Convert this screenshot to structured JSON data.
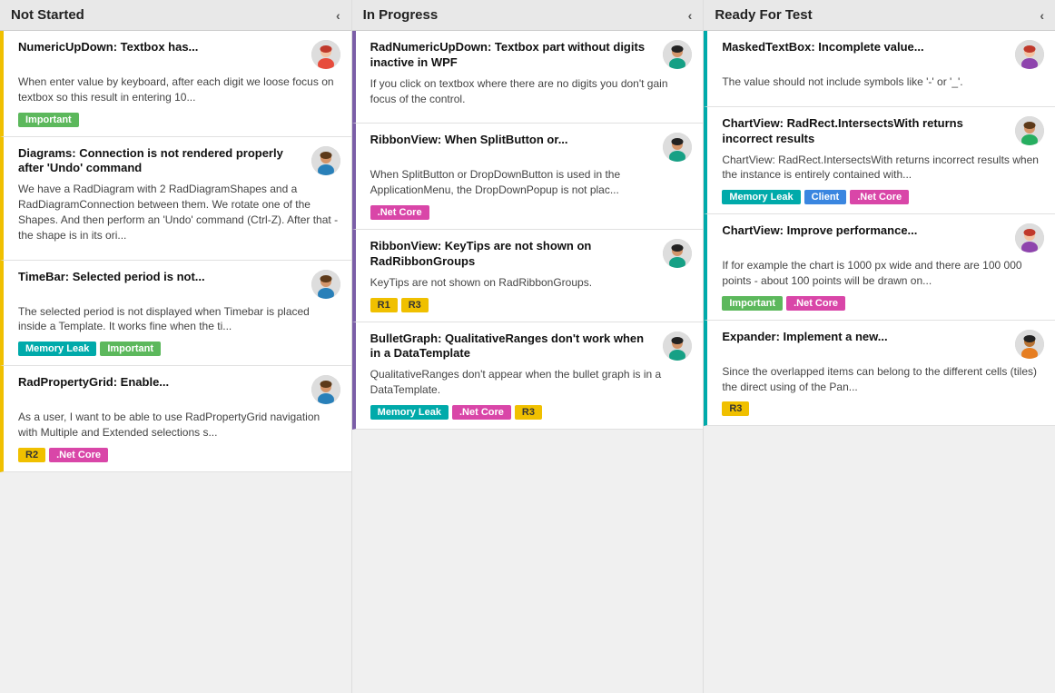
{
  "columns": [
    {
      "id": "not-started",
      "label": "Not Started",
      "cards": [
        {
          "id": "card-1",
          "title": "NumericUpDown: Textbox has...",
          "desc": "When enter value by keyboard, after each digit we loose focus on textbox so this result in entering 10...",
          "tags": [
            {
              "label": "Important",
              "type": "important"
            }
          ],
          "border": "yellow-left",
          "avatar": "female1"
        },
        {
          "id": "card-2",
          "title": "Diagrams: Connection is not rendered properly after 'Undo' command",
          "desc": "We have a RadDiagram with 2 RadDiagramShapes and a RadDiagramConnection between them. We rotate one of the Shapes. And then perform an 'Undo' command (Ctrl-Z). After that - the shape is in its ori...",
          "tags": [],
          "border": "yellow-left",
          "avatar": "male1"
        },
        {
          "id": "card-3",
          "title": "TimeBar: Selected period is not...",
          "desc": "The selected period is not displayed when Timebar is placed inside a Template. It works fine when the ti...",
          "tags": [
            {
              "label": "Memory Leak",
              "type": "memoryleak"
            },
            {
              "label": "Important",
              "type": "important"
            }
          ],
          "border": "yellow-left",
          "avatar": "male1"
        },
        {
          "id": "card-4",
          "title": "RadPropertyGrid: Enable...",
          "desc": "As a user, I want to be able to use RadPropertyGrid navigation with Multiple and Extended selections s...",
          "tags": [
            {
              "label": "R2",
              "type": "r2"
            },
            {
              "label": ".Net Core",
              "type": "netcore"
            }
          ],
          "border": "yellow-left",
          "avatar": "male1"
        }
      ]
    },
    {
      "id": "in-progress",
      "label": "In Progress",
      "cards": [
        {
          "id": "card-5",
          "title": "RadNumericUpDown: Textbox part without digits inactive in WPF",
          "desc": "If you click on textbox where there are no digits you don't gain focus of the control.",
          "tags": [],
          "border": "purple-left",
          "avatar": "male2"
        },
        {
          "id": "card-6",
          "title": "RibbonView: When SplitButton or...",
          "desc": "When SplitButton or DropDownButton is used in the ApplicationMenu, the DropDownPopup is not plac...",
          "tags": [
            {
              "label": ".Net Core",
              "type": "netcore"
            }
          ],
          "border": "purple-left",
          "avatar": "male2"
        },
        {
          "id": "card-7",
          "title": "RibbonView: KeyTips are not shown on RadRibbonGroups",
          "desc": "KeyTips are not shown on RadRibbonGroups.",
          "tags": [
            {
              "label": "R1",
              "type": "r1"
            },
            {
              "label": "R3",
              "type": "r3"
            }
          ],
          "border": "purple-left",
          "avatar": "male2"
        },
        {
          "id": "card-8",
          "title": "BulletGraph: QualitativeRanges don't work when in a DataTemplate",
          "desc": "QualitativeRanges don't appear when the bullet graph is in a DataTemplate.",
          "tags": [
            {
              "label": "Memory Leak",
              "type": "memoryleak"
            },
            {
              "label": ".Net Core",
              "type": "netcore"
            },
            {
              "label": "R3",
              "type": "r3"
            }
          ],
          "border": "purple-left",
          "avatar": "male2"
        }
      ]
    },
    {
      "id": "ready-for-test",
      "label": "Ready For Test",
      "cards": [
        {
          "id": "card-9",
          "title": "MaskedTextBox: Incomplete value...",
          "desc": "The value should not include symbols like '-' or '_'.",
          "tags": [],
          "border": "teal-left",
          "avatar": "female2"
        },
        {
          "id": "card-10",
          "title": "ChartView: RadRect.IntersectsWith returns incorrect results",
          "desc": "ChartView: RadRect.IntersectsWith returns incorrect results when the instance is entirely contained with...",
          "tags": [
            {
              "label": "Memory Leak",
              "type": "memoryleak"
            },
            {
              "label": "Client",
              "type": "client"
            },
            {
              "label": ".Net Core",
              "type": "netcore"
            }
          ],
          "border": "teal-left",
          "avatar": "male3"
        },
        {
          "id": "card-11",
          "title": "ChartView: Improve performance...",
          "desc": "If for example the chart is 1000 px wide and there are 100 000 points - about 100 points will be drawn on...",
          "tags": [
            {
              "label": "Important",
              "type": "important"
            },
            {
              "label": ".Net Core",
              "type": "netcore"
            }
          ],
          "border": "teal-left",
          "avatar": "female2"
        },
        {
          "id": "card-12",
          "title": "Expander: Implement a new...",
          "desc": "Since the overlapped items can belong to the different cells (tiles) the direct using of the Pan...",
          "tags": [
            {
              "label": "R3",
              "type": "r3"
            }
          ],
          "border": "teal-left",
          "avatar": "male4"
        }
      ]
    }
  ],
  "chevron": "‹"
}
